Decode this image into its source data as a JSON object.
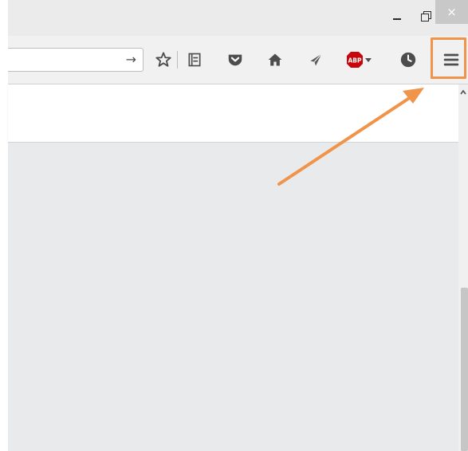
{
  "window": {
    "close_symbol": "×"
  },
  "toolbar": {
    "go_symbol": "→",
    "adblock_badge": "ABP",
    "icons": [
      "go-arrow-icon",
      "bookmark-star-icon",
      "reading-list-icon",
      "pocket-icon",
      "home-icon",
      "send-icon",
      "adblock-plus-icon",
      "history-icon",
      "hamburger-menu-icon"
    ]
  },
  "colors": {
    "highlight": "#f0944a",
    "adblock": "#c7050b",
    "content_bg": "#e8eaec"
  }
}
